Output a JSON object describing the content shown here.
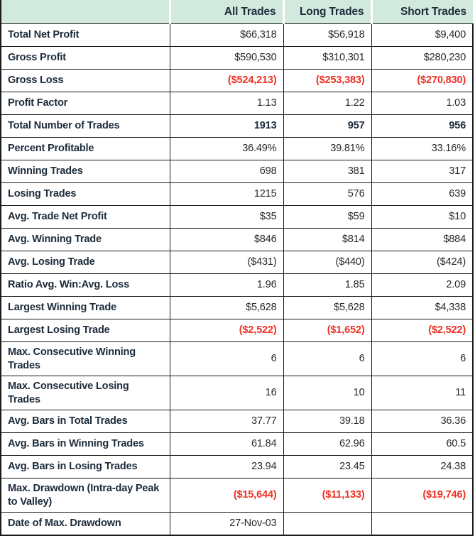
{
  "table": {
    "name": "strategy-performance-report",
    "columns": [
      {
        "key": "label",
        "label": ""
      },
      {
        "key": "all",
        "label": "All Trades"
      },
      {
        "key": "long",
        "label": "Long Trades"
      },
      {
        "key": "short",
        "label": "Short Trades"
      }
    ],
    "colors": {
      "header_background": "#d2e9dd",
      "label_text": "#1c2b3a",
      "value_text": "#2a2a2a",
      "negative_value_text": "#ee3124",
      "border": "#1a1a1a"
    },
    "rows": [
      {
        "label": "Total Net Profit",
        "all": "$66,318",
        "long": "$56,918",
        "short": "$9,400",
        "style": "normal",
        "lines": 1
      },
      {
        "label": "Gross Profit",
        "all": "$590,530",
        "long": "$310,301",
        "short": "$280,230",
        "style": "normal",
        "lines": 1
      },
      {
        "label": "Gross Loss",
        "all": "($524,213)",
        "long": "($253,383)",
        "short": "($270,830)",
        "style": "negative",
        "lines": 1
      },
      {
        "label": "Profit Factor",
        "all": "1.13",
        "long": "1.22",
        "short": "1.03",
        "style": "normal",
        "lines": 1
      },
      {
        "label": "Total Number of Trades",
        "all": "1913",
        "long": "957",
        "short": "956",
        "style": "strong",
        "lines": 1
      },
      {
        "label": "Percent Profitable",
        "all": "36.49%",
        "long": "39.81%",
        "short": "33.16%",
        "style": "normal",
        "lines": 1
      },
      {
        "label": "Winning Trades",
        "all": "698",
        "long": "381",
        "short": "317",
        "style": "normal",
        "lines": 1
      },
      {
        "label": "Losing Trades",
        "all": "1215",
        "long": "576",
        "short": "639",
        "style": "normal",
        "lines": 1
      },
      {
        "label": "Avg. Trade Net Profit",
        "all": "$35",
        "long": "$59",
        "short": "$10",
        "style": "normal",
        "lines": 1
      },
      {
        "label": "Avg. Winning Trade",
        "all": "$846",
        "long": "$814",
        "short": "$884",
        "style": "normal",
        "lines": 1
      },
      {
        "label": "Avg. Losing Trade",
        "all": "($431)",
        "long": "($440)",
        "short": "($424)",
        "style": "normal",
        "lines": 1
      },
      {
        "label": "Ratio Avg. Win:Avg. Loss",
        "all": "1.96",
        "long": "1.85",
        "short": "2.09",
        "style": "normal",
        "lines": 1
      },
      {
        "label": "Largest Winning Trade",
        "all": "$5,628",
        "long": "$5,628",
        "short": "$4,338",
        "style": "normal",
        "lines": 1
      },
      {
        "label": "Largest Losing Trade",
        "all": "($2,522)",
        "long": "($1,652)",
        "short": "($2,522)",
        "style": "negative",
        "lines": 1
      },
      {
        "label": "Max. Consecutive Winning Trades",
        "all": "6",
        "long": "6",
        "short": "6",
        "style": "normal",
        "lines": 2
      },
      {
        "label": "Max. Consecutive Losing Trades",
        "all": "16",
        "long": "10",
        "short": "11",
        "style": "normal",
        "lines": 2
      },
      {
        "label": "Avg. Bars in Total Trades",
        "all": "37.77",
        "long": "39.18",
        "short": "36.36",
        "style": "normal",
        "lines": 1
      },
      {
        "label": "Avg. Bars in Winning Trades",
        "all": "61.84",
        "long": "62.96",
        "short": "60.5",
        "style": "normal",
        "lines": 1
      },
      {
        "label": "Avg. Bars in Losing Trades",
        "all": "23.94",
        "long": "23.45",
        "short": "24.38",
        "style": "normal",
        "lines": 1
      },
      {
        "label": "Max. Drawdown (Intra-day Peak to Valley)",
        "all": "($15,644)",
        "long": "($11,133)",
        "short": "($19,746)",
        "style": "negative",
        "lines": 2
      },
      {
        "label": "Date of Max. Drawdown",
        "all": "27-Nov-03",
        "long": "",
        "short": "",
        "style": "normal",
        "lines": 1
      }
    ]
  }
}
